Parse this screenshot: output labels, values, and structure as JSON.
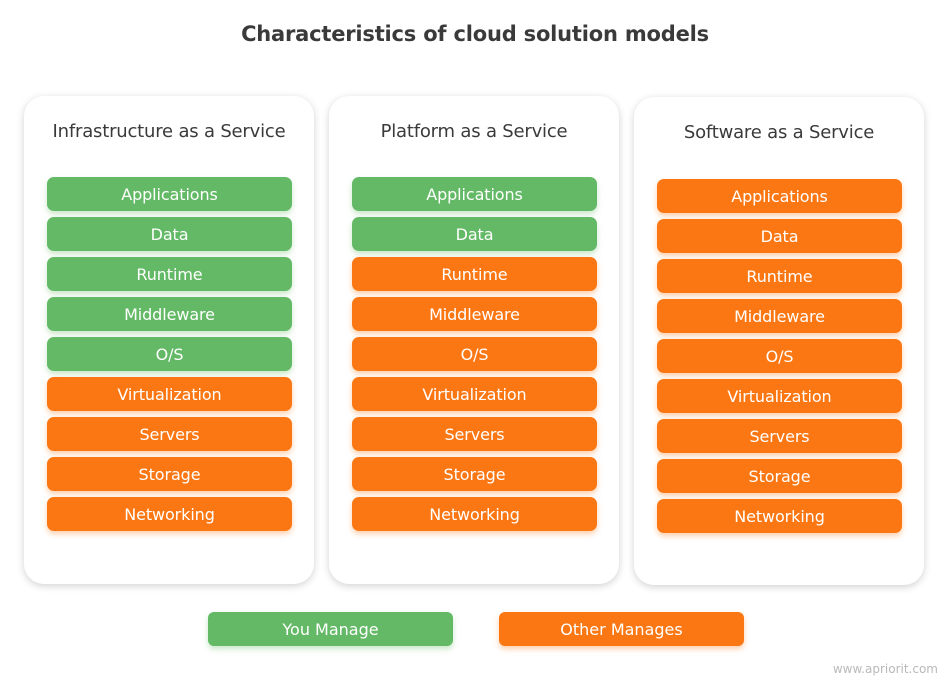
{
  "title": "Characteristics of cloud solution models",
  "colors": {
    "you_manage": "#63b965",
    "other_manages": "#fb7713"
  },
  "models": [
    {
      "name": "Infrastructure as a Service",
      "layers": [
        {
          "label": "Applications",
          "manager": "you"
        },
        {
          "label": "Data",
          "manager": "you"
        },
        {
          "label": "Runtime",
          "manager": "you"
        },
        {
          "label": "Middleware",
          "manager": "you"
        },
        {
          "label": "O/S",
          "manager": "you"
        },
        {
          "label": "Virtualization",
          "manager": "other"
        },
        {
          "label": "Servers",
          "manager": "other"
        },
        {
          "label": "Storage",
          "manager": "other"
        },
        {
          "label": "Networking",
          "manager": "other"
        }
      ]
    },
    {
      "name": "Platform as a Service",
      "layers": [
        {
          "label": "Applications",
          "manager": "you"
        },
        {
          "label": "Data",
          "manager": "you"
        },
        {
          "label": "Runtime",
          "manager": "other"
        },
        {
          "label": "Middleware",
          "manager": "other"
        },
        {
          "label": "O/S",
          "manager": "other"
        },
        {
          "label": "Virtualization",
          "manager": "other"
        },
        {
          "label": "Servers",
          "manager": "other"
        },
        {
          "label": "Storage",
          "manager": "other"
        },
        {
          "label": "Networking",
          "manager": "other"
        }
      ]
    },
    {
      "name": "Software as a Service",
      "layers": [
        {
          "label": "Applications",
          "manager": "other"
        },
        {
          "label": "Data",
          "manager": "other"
        },
        {
          "label": "Runtime",
          "manager": "other"
        },
        {
          "label": "Middleware",
          "manager": "other"
        },
        {
          "label": "O/S",
          "manager": "other"
        },
        {
          "label": "Virtualization",
          "manager": "other"
        },
        {
          "label": "Servers",
          "manager": "other"
        },
        {
          "label": "Storage",
          "manager": "other"
        },
        {
          "label": "Networking",
          "manager": "other"
        }
      ]
    }
  ],
  "legend": {
    "you_manage": "You Manage",
    "other_manages": "Other Manages"
  },
  "watermark": "www.apriorit.com"
}
